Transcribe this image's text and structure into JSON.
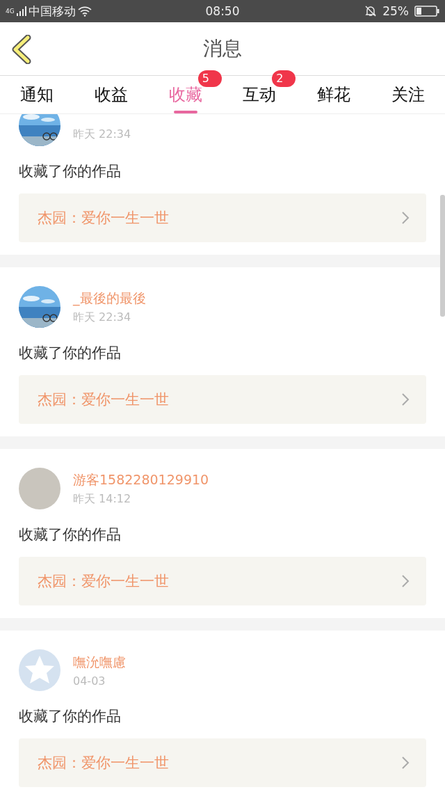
{
  "status_bar": {
    "network": "4G",
    "carrier": "中国移动",
    "time": "08:50",
    "battery": "25%"
  },
  "header": {
    "title": "消息"
  },
  "tabs": [
    {
      "label": "通知",
      "selected": false
    },
    {
      "label": "收益",
      "selected": false
    },
    {
      "label": "收藏",
      "selected": true,
      "badge": "5"
    },
    {
      "label": "互动",
      "selected": false,
      "badge": "2"
    },
    {
      "label": "鲜花",
      "selected": false
    },
    {
      "label": "关注",
      "selected": false
    }
  ],
  "messages": [
    {
      "kind": "picture",
      "time": "昨天 22:34",
      "text": "收藏了你的作品",
      "work": "杰园：爱你一生一世"
    },
    {
      "kind": "picture",
      "name": "_最後的最後",
      "time": "昨天 22:34",
      "text": "收藏了你的作品",
      "work": "杰园：爱你一生一世"
    },
    {
      "kind": "plain",
      "name": "游客1582280129910",
      "time": "昨天 14:12",
      "text": "收藏了你的作品",
      "work": "杰园：爱你一生一世"
    },
    {
      "kind": "star",
      "name": "嘸沇嘸慮",
      "time": "04-03",
      "text": "收藏了你的作品",
      "work": "杰园：爱你一生一世"
    }
  ]
}
